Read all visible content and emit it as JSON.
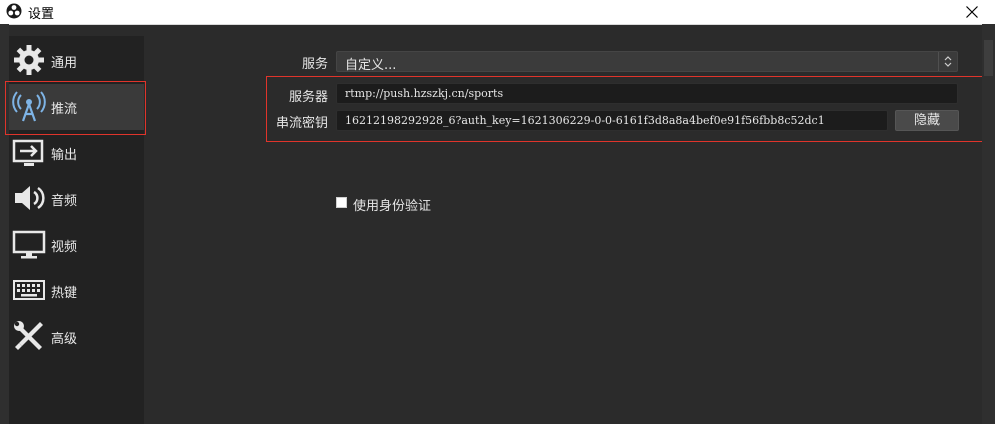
{
  "window": {
    "title": "设置",
    "close_icon": "close-icon",
    "app_icon": "obs-logo-icon"
  },
  "sidebar": {
    "items": [
      {
        "label": "通用",
        "icon": "gear-icon"
      },
      {
        "label": "推流",
        "icon": "broadcast-icon",
        "active": true
      },
      {
        "label": "输出",
        "icon": "output-icon"
      },
      {
        "label": "音频",
        "icon": "speaker-icon"
      },
      {
        "label": "视频",
        "icon": "monitor-icon"
      },
      {
        "label": "热键",
        "icon": "keyboard-icon"
      },
      {
        "label": "高级",
        "icon": "tools-icon"
      }
    ]
  },
  "stream": {
    "service_label": "服务",
    "service_value": "自定义...",
    "server_label": "服务器",
    "server_value": "rtmp://push.hzszkj.cn/sports",
    "key_label": "串流密钥",
    "key_value": "16212198292928_6?auth_key=1621306229-0-0-6161f3d8a8a4bef0e91f56fbb8c52dc1",
    "hide_button": "隐藏",
    "auth_checkbox_label": "使用身份验证",
    "auth_checked": false
  },
  "colors": {
    "highlight_border": "#e0342b",
    "background": "#2b2b2b",
    "sidebar": "#222222"
  }
}
